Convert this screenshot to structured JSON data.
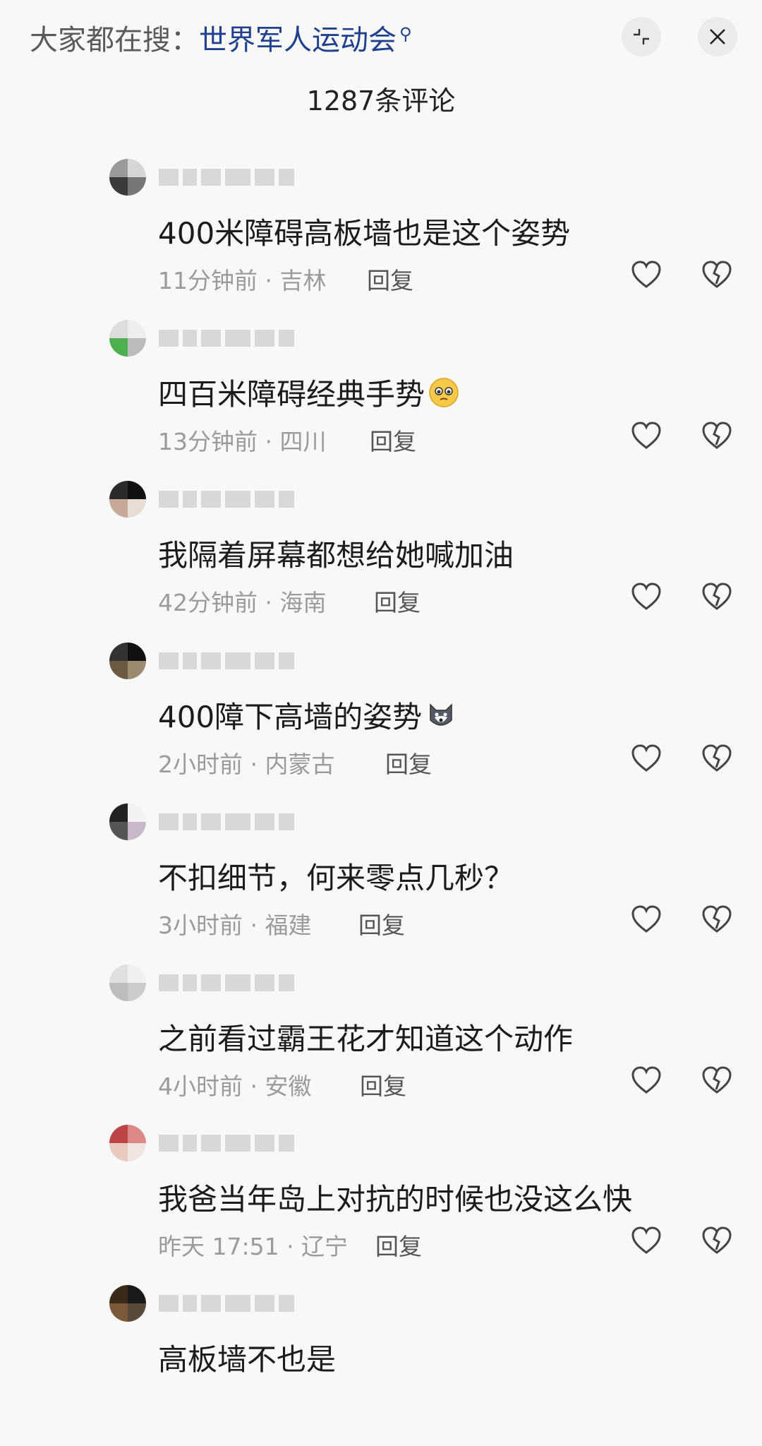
{
  "header": {
    "search_prefix": "大家都在搜：",
    "search_keyword": "世界军人运动会",
    "collapse_icon": "collapse-icon",
    "close_icon": "close-icon"
  },
  "comment_count": "1287条评论",
  "comments": [
    {
      "text": "400米障碍高板墙也是这个姿势",
      "meta": "11分钟前 · 吉林",
      "reply": "回复"
    },
    {
      "text": "四百米障碍经典手势",
      "meta": "13分钟前 · 四川",
      "reply": "回复",
      "emoji": "pleading-face"
    },
    {
      "text": "我隔着屏幕都想给她喊加油",
      "meta": "42分钟前 · 海南",
      "reply": "回复"
    },
    {
      "text": "400障下高墙的姿势",
      "meta": "2小时前 · 内蒙古",
      "reply": "回复",
      "emoji": "dog-face"
    },
    {
      "text": "不扣细节，何来零点几秒？",
      "meta": "3小时前 · 福建",
      "reply": "回复"
    },
    {
      "text": "之前看过霸王花才知道这个动作",
      "meta": "4小时前 · 安徽",
      "reply": "回复"
    },
    {
      "text": "我爸当年岛上对抗的时候也没这么快",
      "meta": "昨天 17:51 · 辽宁",
      "reply": "回复"
    },
    {
      "text": "高板墙不也是",
      "meta": "",
      "reply": ""
    }
  ]
}
